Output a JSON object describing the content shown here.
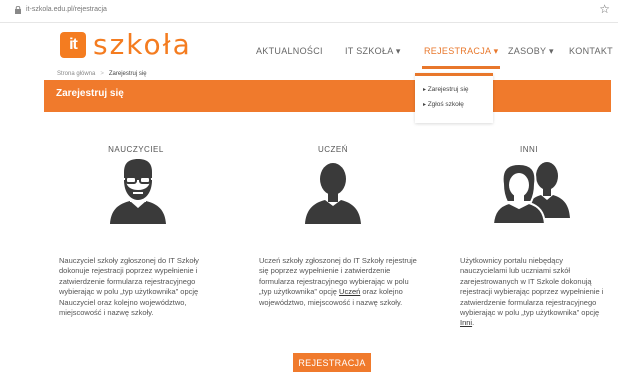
{
  "browser": {
    "url": "it-szkola.edu.pl/rejestracja"
  },
  "header": {
    "logo_box_text": "it",
    "logo_word": "szkoła",
    "nav": [
      {
        "label": "AKTUALNOŚCI"
      },
      {
        "label": "IT SZKOŁA ▾"
      },
      {
        "label": "REJESTRACJA ▾"
      },
      {
        "label": "ZASOBY ▾"
      },
      {
        "label": "KONTAKT"
      }
    ]
  },
  "breadcrumb": {
    "home": "Strona główna",
    "separator": ">",
    "current": "Zarejestruj się"
  },
  "banner": {
    "title": "Zarejestruj się"
  },
  "dropdown": {
    "items": [
      {
        "label": "Zarejestruj się"
      },
      {
        "label": "Zgłoś szkołę"
      }
    ]
  },
  "columns": [
    {
      "heading": "NAUCZYCIEL",
      "text": "Nauczyciel szkoły zgłoszonej do IT Szkoły dokonuje rejestracji poprzez wypełnienie i zatwierdzenie formularza rejestracyjnego wybierając w polu „typ użytkownika” opcję Nauczyciel oraz kolejno województwo, miejscowość i nazwę szkoły."
    },
    {
      "heading": "UCZEŃ",
      "text_before": "Uczeń szkoły zgłoszonej do IT Szkoły rejestruje się poprzez wypełnienie i zatwierdzenie formularza rejestracyjnego wybierając w polu „typ użytkownika” opcję ",
      "link": "Uczeń",
      "text_after": " oraz kolejno województwo, miejscowość i nazwę szkoły."
    },
    {
      "heading": "INNI",
      "text_before": "Użytkownicy portalu niebędący nauczycielami lub uczniami szkół zarejestrowanych w IT Szkole dokonują rejestracji wybierając poprzez wypełnienie i zatwierdzenie formularza rejestracyjnego wybierając w polu „typ użytkownika” opcję ",
      "link": "Inni",
      "text_after": "."
    }
  ],
  "cta": {
    "label": "REJESTRACJA"
  },
  "colors": {
    "accent": "#f07a2c",
    "avatar": "#3a3a3a"
  }
}
